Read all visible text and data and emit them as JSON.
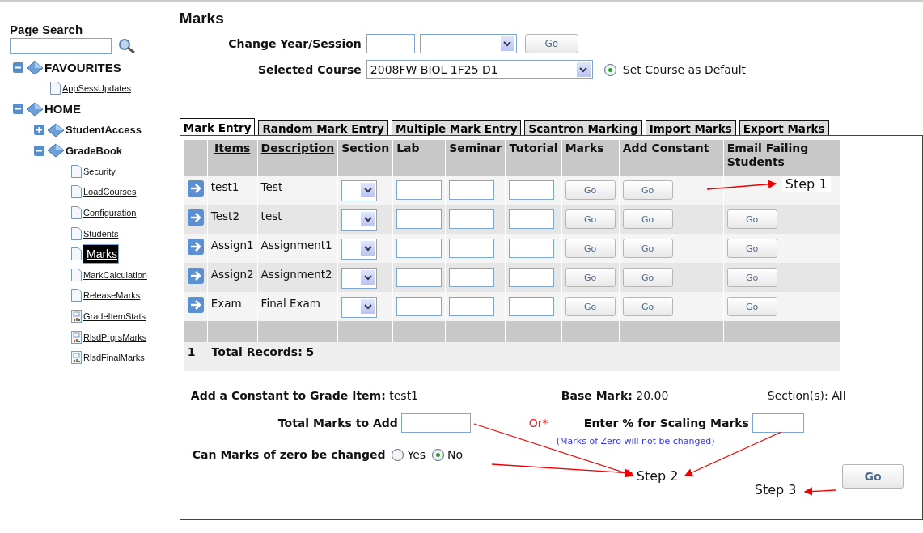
{
  "sidebar": {
    "search_title": "Page Search",
    "tree": [
      {
        "label": "FAVOURITES",
        "kind": "folder",
        "expanded": true,
        "children": [
          {
            "label": "AppSessUpdates",
            "kind": "page",
            "selected": false
          }
        ]
      },
      {
        "label": "HOME",
        "kind": "folder",
        "expanded": true,
        "children": [
          {
            "label": "StudentAccess",
            "kind": "folder",
            "expanded": false
          },
          {
            "label": "GradeBook",
            "kind": "folder",
            "expanded": true,
            "children": [
              {
                "label": "Security",
                "kind": "page",
                "selected": false
              },
              {
                "label": "LoadCourses",
                "kind": "page",
                "selected": false
              },
              {
                "label": "Configuration",
                "kind": "page",
                "selected": false
              },
              {
                "label": "Students",
                "kind": "page",
                "selected": false
              },
              {
                "label": "Marks",
                "kind": "page",
                "selected": true
              },
              {
                "label": "MarkCalculation",
                "kind": "page",
                "selected": false
              },
              {
                "label": "ReleaseMarks",
                "kind": "page",
                "selected": false
              },
              {
                "label": "GradeItemStats",
                "kind": "report",
                "selected": false
              },
              {
                "label": "RlsdPrgrsMarks",
                "kind": "report",
                "selected": false
              },
              {
                "label": "RlsdFinalMarks",
                "kind": "report",
                "selected": false
              }
            ]
          }
        ]
      }
    ]
  },
  "page_title": "Marks",
  "year_session": {
    "label": "Change Year/Session",
    "button": "Go"
  },
  "course": {
    "label": "Selected Course",
    "value": "2008FW BIOL 1F25 D1",
    "default_label": "Set Course as Default",
    "default_checked": true
  },
  "tabs": [
    {
      "label": "Mark Entry",
      "selected": true
    },
    {
      "label": "Random Mark Entry",
      "selected": false
    },
    {
      "label": "Multiple Mark Entry",
      "selected": false
    },
    {
      "label": "Scantron Marking",
      "selected": false
    },
    {
      "label": "Import Marks",
      "selected": false
    },
    {
      "label": "Export Marks",
      "selected": false
    }
  ],
  "table": {
    "columns": [
      {
        "label": "Items",
        "sortable": true
      },
      {
        "label": "Description",
        "sortable": true
      },
      {
        "label": "Section",
        "sortable": false
      },
      {
        "label": "Lab",
        "sortable": false
      },
      {
        "label": "Seminar",
        "sortable": false
      },
      {
        "label": "Tutorial",
        "sortable": false
      },
      {
        "label": "Marks",
        "sortable": false
      },
      {
        "label": "Add Constant",
        "sortable": false
      },
      {
        "label": "Email Failing Students",
        "sortable": false
      }
    ],
    "rows": [
      {
        "item": "test1",
        "description": "Test",
        "marks_button": "Go",
        "constant_button": "Go"
      },
      {
        "item": "Test2",
        "description": "test",
        "marks_button": "Go",
        "constant_button": "Go",
        "email_button": "Go"
      },
      {
        "item": "Assign1",
        "description": "Assignment1",
        "marks_button": "Go",
        "constant_button": "Go",
        "email_button": "Go"
      },
      {
        "item": "Assign2",
        "description": "Assignment2",
        "marks_button": "Go",
        "constant_button": "Go",
        "email_button": "Go"
      },
      {
        "item": "Exam",
        "description": "Final Exam",
        "marks_button": "Go",
        "constant_button": "Go",
        "email_button": "Go"
      }
    ],
    "pager": "1",
    "total": "Total Records: 5"
  },
  "constant": {
    "label": "Add a Constant to Grade Item:",
    "item": "test1",
    "base_label": "Base Mark:",
    "base_value": "20.00",
    "sections": "Section(s): All",
    "total_label": "Total Marks to Add",
    "or": "Or*",
    "scaling_label": "Enter % for Scaling Marks",
    "note": "(Marks of Zero will not be changed)",
    "zero_label": "Can Marks of zero be changed",
    "options": [
      {
        "label": "Yes",
        "selected": false
      },
      {
        "label": "No",
        "selected": true
      }
    ],
    "button": "Go"
  },
  "annotations": [
    {
      "label": "Step 1"
    },
    {
      "label": "Step 2"
    },
    {
      "label": "Step 3"
    }
  ]
}
